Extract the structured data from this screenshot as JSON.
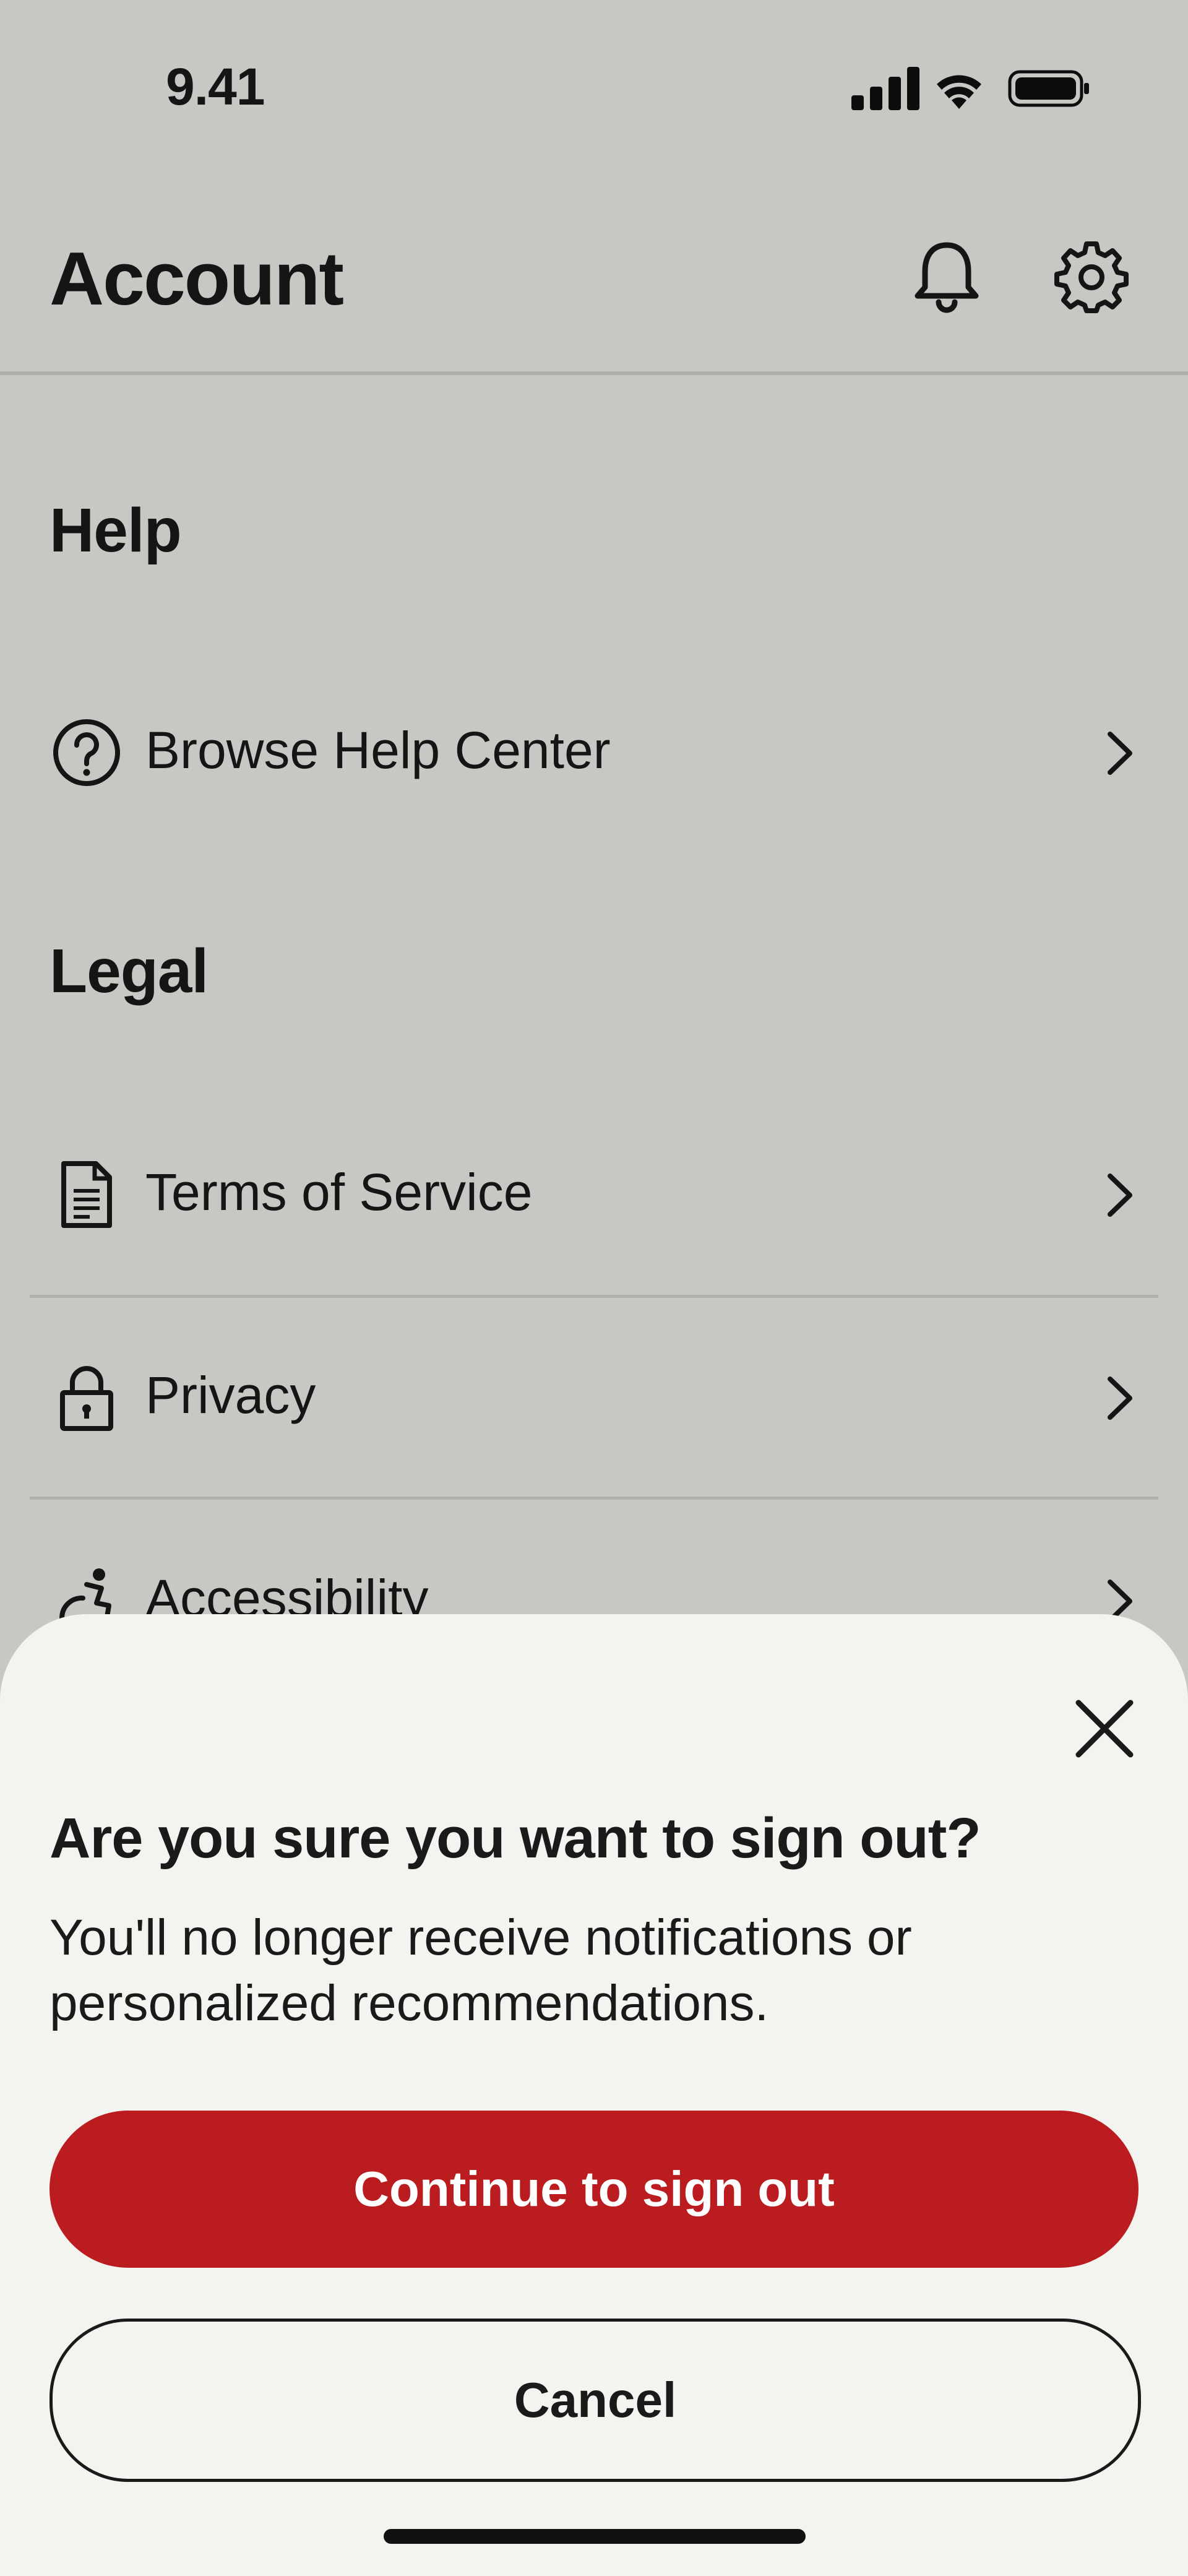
{
  "status_bar": {
    "time": "9.41",
    "icons": [
      "cellular-signal-icon",
      "wifi-icon",
      "battery-icon"
    ]
  },
  "header": {
    "title": "Account",
    "actions": [
      "bell-icon",
      "gear-icon"
    ]
  },
  "sections": [
    {
      "heading": "Help",
      "items": [
        {
          "label": "Browse Help Center",
          "icon": "help-circle-icon"
        }
      ]
    },
    {
      "heading": "Legal",
      "items": [
        {
          "label": "Terms of Service",
          "icon": "document-icon"
        },
        {
          "label": "Privacy",
          "icon": "lock-icon"
        },
        {
          "label": "Accessibility",
          "icon": "accessibility-icon"
        }
      ]
    }
  ],
  "dialog": {
    "title": "Are you sure you want to sign out?",
    "body": "You'll no longer receive notifications or personalized recommendations.",
    "confirm_label": "Continue to sign out",
    "cancel_label": "Cancel"
  },
  "colors": {
    "accent": "#bb1c20",
    "background": "#f3f3ef",
    "text": "#1a1a1a"
  }
}
